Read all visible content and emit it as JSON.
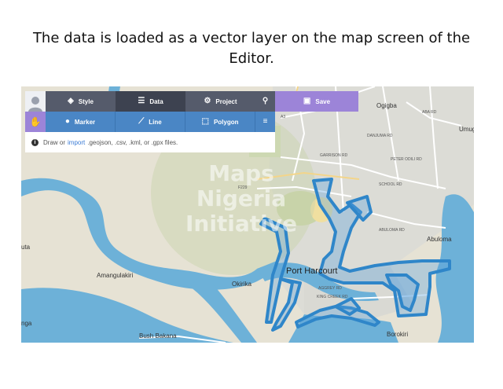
{
  "caption": {
    "line1": "The data is loaded as a vector layer on the map screen of the",
    "line2": "Editor."
  },
  "toolbar": {
    "row1": [
      {
        "label": "Style",
        "icon": "paint-icon",
        "glyph": "◈",
        "color": "#555b6b"
      },
      {
        "label": "Data",
        "icon": "list-icon",
        "glyph": "☰",
        "color": "#3d4250"
      },
      {
        "label": "Project",
        "icon": "gear-icon",
        "glyph": "⚙",
        "color": "#555b6b"
      },
      {
        "label": "",
        "icon": "search-icon",
        "glyph": "⚲",
        "color": "#555b6b"
      },
      {
        "label": "Save",
        "icon": "save-icon",
        "glyph": "▣",
        "color": "#9c84d8"
      }
    ],
    "row2": [
      {
        "label": "Marker",
        "icon": "marker-icon",
        "glyph": "●",
        "color": "#4a86c5"
      },
      {
        "label": "Line",
        "icon": "line-icon",
        "glyph": "⟋",
        "color": "#4a86c5"
      },
      {
        "label": "Polygon",
        "icon": "polygon-icon",
        "glyph": "⬚",
        "color": "#4a86c5"
      },
      {
        "label": "",
        "icon": "menu-icon",
        "glyph": "≡",
        "color": "#4a86c5"
      }
    ]
  },
  "draw_tip": {
    "prefix": "Draw or",
    "link": "import",
    "suffix": ".geojson, .csv, .kml, or .gpx files."
  },
  "watermark": {
    "line1": "Maps",
    "line2": "Nigeria",
    "line3": "Initiative"
  },
  "places": {
    "port_harcourt": "Port Harcourt",
    "amangulakiri": "Amangulakiri",
    "okirika": "Okirika",
    "abuloma": "Abuloma",
    "bush_bakana": "Bush Bakana",
    "borokiri": "Borokiri",
    "ogigba": "Ogigba",
    "umug": "Umug",
    "uta": "uta",
    "nga": "nga"
  },
  "roads": {
    "a3": "A3",
    "f229": "F229",
    "abuloma_rd": "ABULOMA RD",
    "school_rd": "SCHOOL RD",
    "aggrey_rd": "AGGREY RD",
    "king_creek_rd": "KING CREEK RD",
    "garrison_rd": "GARRISON RD",
    "danjuma_rd": "DANJUMA RD",
    "peter_odili_rd": "PETER ODILI RD",
    "aba_rd": "ABA RD"
  }
}
